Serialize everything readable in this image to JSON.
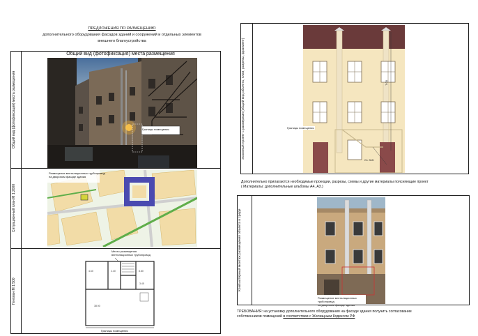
{
  "header": {
    "title": "ПРЕДЛОЖЕНИЯ ПО РАЗМЕЩЕНИЮ",
    "line2": "дополнительного оборудования фасадов зданий и сооружений и отдельных элементов",
    "line3": "внешнего благоустройства"
  },
  "left_panel": {
    "photo_title": "Общий вид (фотофиксация) места размещения",
    "row1_label": "Общий вид (фотофиксация) места размещения",
    "row2_label": "Ситуационный план М 1:2000",
    "row3_label": "Генплан М 1:500",
    "photo_callout": "Границы помещения",
    "map_callout_line1": "Размещение вентиляционных трубопровод",
    "map_callout_line2": "на дворовом фасаде здания",
    "plan_callout_line1": "Место размещения",
    "plan_callout_line2": "вентиляционных трубопровод",
    "plan_bottom_label": "Границы помещения"
  },
  "right_panel": {
    "sketch_label": "Эскизный проект с размерами (общий вид объекта, план, разрезы, фрагмент)",
    "sketch_callout": "Границы помещения",
    "dim_vertical": "7.00",
    "dim_bottom": "О= 315",
    "note_line1": "Дополнительно прилагаются необходимые проекции, разрезы, схемы и другие материалы поясняющие проект",
    "note_line2": "( Материалы: дополнительные альбомы А4, А3.)",
    "montage_label": "Компьютерный монтаж размещения объекта в среде",
    "montage_caption_line1": "Размещение вентиляционных трубопровод",
    "montage_caption_line2": "на дворовом фасаде здания"
  },
  "requirements": {
    "line1": "ТРЕБОВАНИЯ: на установку дополнительного оборудования на фасаде здания получить согласование",
    "line2_prefix": "собственников помещений ",
    "line2_link": "в   соответствии с Жилищным Кодексом РФ"
  }
}
